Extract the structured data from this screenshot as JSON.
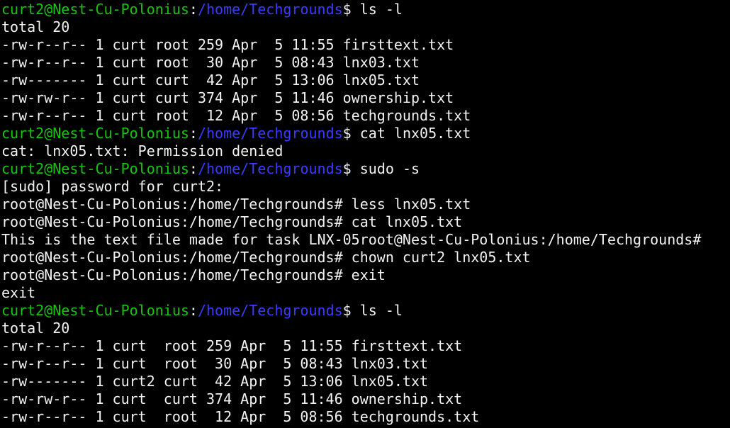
{
  "colors": {
    "background": "#000000",
    "foreground": "#f2f2f2",
    "user_host": "#16c60c",
    "path": "#3b3bff"
  },
  "lines": [
    {
      "type": "prompt",
      "user_host": "curt2@Nest-Cu-Polonius",
      "sep": ":",
      "path": "/home/Techgrounds",
      "symbol": "$ ",
      "command": "ls -l"
    },
    {
      "type": "output",
      "text": "total 20"
    },
    {
      "type": "output",
      "text": "-rw-r--r-- 1 curt root 259 Apr  5 11:55 firsttext.txt"
    },
    {
      "type": "output",
      "text": "-rw-r--r-- 1 curt root  30 Apr  5 08:43 lnx03.txt"
    },
    {
      "type": "output",
      "text": "-rw------- 1 curt curt  42 Apr  5 13:06 lnx05.txt"
    },
    {
      "type": "output",
      "text": "-rw-rw-r-- 1 curt curt 374 Apr  5 11:46 ownership.txt"
    },
    {
      "type": "output",
      "text": "-rw-r--r-- 1 curt root  12 Apr  5 08:56 techgrounds.txt"
    },
    {
      "type": "prompt",
      "user_host": "curt2@Nest-Cu-Polonius",
      "sep": ":",
      "path": "/home/Techgrounds",
      "symbol": "$ ",
      "command": "cat lnx05.txt"
    },
    {
      "type": "output",
      "text": "cat: lnx05.txt: Permission denied"
    },
    {
      "type": "prompt",
      "user_host": "curt2@Nest-Cu-Polonius",
      "sep": ":",
      "path": "/home/Techgrounds",
      "symbol": "$ ",
      "command": "sudo -s"
    },
    {
      "type": "output",
      "text": "[sudo] password for curt2:"
    },
    {
      "type": "output",
      "text": "root@Nest-Cu-Polonius:/home/Techgrounds# less lnx05.txt"
    },
    {
      "type": "output",
      "text": "root@Nest-Cu-Polonius:/home/Techgrounds# cat lnx05.txt"
    },
    {
      "type": "output",
      "text": "This is the text file made for task LNX-05root@Nest-Cu-Polonius:/home/Techgrounds#"
    },
    {
      "type": "output",
      "text": "root@Nest-Cu-Polonius:/home/Techgrounds# chown curt2 lnx05.txt"
    },
    {
      "type": "output",
      "text": "root@Nest-Cu-Polonius:/home/Techgrounds# exit"
    },
    {
      "type": "output",
      "text": "exit"
    },
    {
      "type": "prompt",
      "user_host": "curt2@Nest-Cu-Polonius",
      "sep": ":",
      "path": "/home/Techgrounds",
      "symbol": "$ ",
      "command": "ls -l"
    },
    {
      "type": "output",
      "text": "total 20"
    },
    {
      "type": "output",
      "text": "-rw-r--r-- 1 curt  root 259 Apr  5 11:55 firsttext.txt"
    },
    {
      "type": "output",
      "text": "-rw-r--r-- 1 curt  root  30 Apr  5 08:43 lnx03.txt"
    },
    {
      "type": "output",
      "text": "-rw------- 1 curt2 curt  42 Apr  5 13:06 lnx05.txt"
    },
    {
      "type": "output",
      "text": "-rw-rw-r-- 1 curt  curt 374 Apr  5 11:46 ownership.txt"
    },
    {
      "type": "output",
      "text": "-rw-r--r-- 1 curt  root  12 Apr  5 08:56 techgrounds.txt"
    }
  ]
}
